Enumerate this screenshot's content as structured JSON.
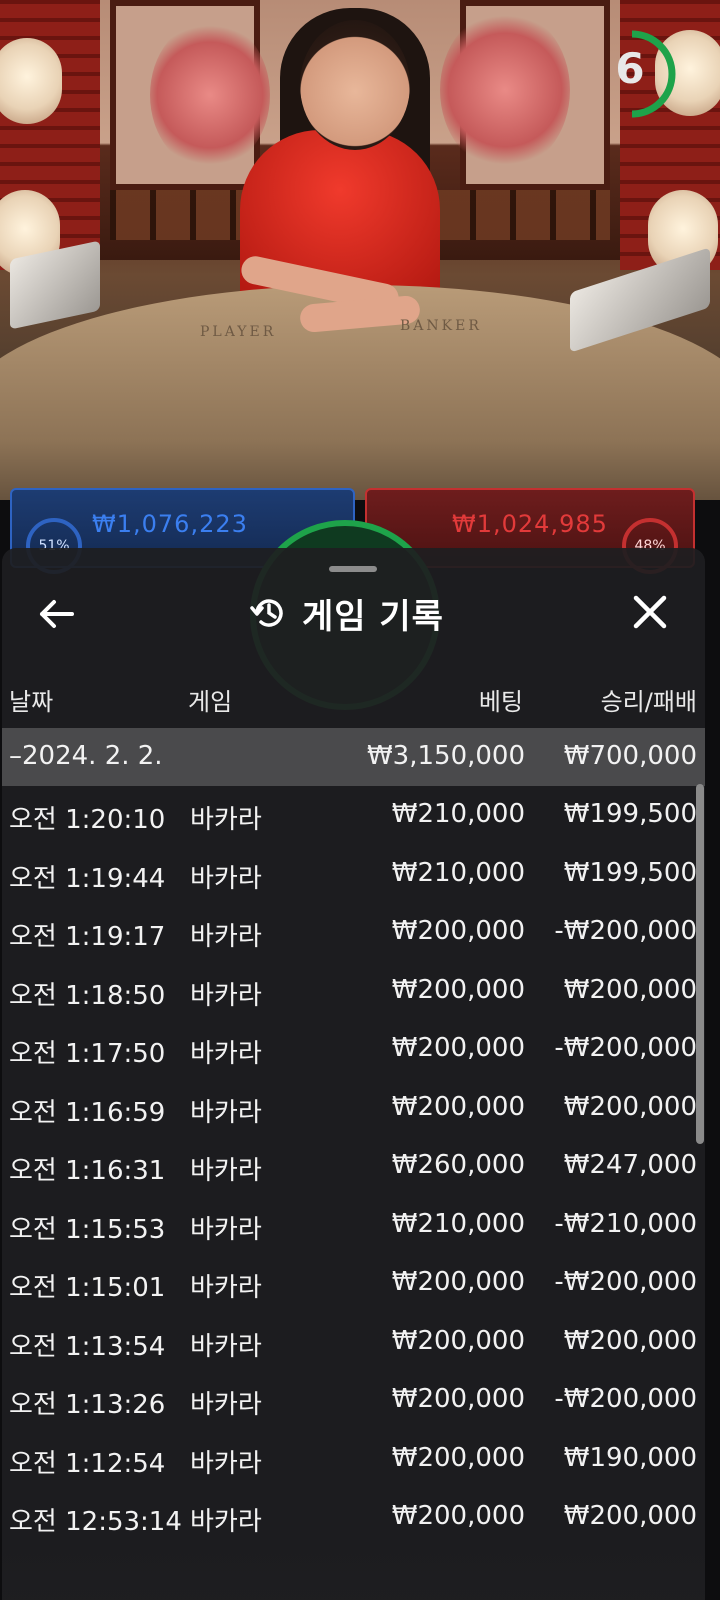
{
  "video": {
    "timer_value": "6",
    "table_label_player": "PLAYER",
    "table_label_banker": "BANKER"
  },
  "bet_panels": {
    "player_amount": "₩1,076,223",
    "player_percent": "51%",
    "banker_amount": "₩1,024,985",
    "banker_percent": "48%"
  },
  "sheet": {
    "title": "게임 기록",
    "back_icon": "arrow-left-icon",
    "history_icon": "history-icon",
    "close_icon": "close-icon",
    "columns": {
      "date": "날짜",
      "game": "게임",
      "bet": "베팅",
      "win_loss": "승리/패배"
    },
    "date_group": {
      "label": "–2024. 2. 2.",
      "bet_total": "₩3,150,000",
      "win_total": "₩700,000"
    },
    "rows": [
      {
        "time": "오전 1:20:10",
        "game": "바카라",
        "bet": "₩210,000",
        "result": "₩199,500"
      },
      {
        "time": "오전 1:19:44",
        "game": "바카라",
        "bet": "₩210,000",
        "result": "₩199,500"
      },
      {
        "time": "오전 1:19:17",
        "game": "바카라",
        "bet": "₩200,000",
        "result": "-₩200,000"
      },
      {
        "time": "오전 1:18:50",
        "game": "바카라",
        "bet": "₩200,000",
        "result": "₩200,000"
      },
      {
        "time": "오전 1:17:50",
        "game": "바카라",
        "bet": "₩200,000",
        "result": "-₩200,000"
      },
      {
        "time": "오전 1:16:59",
        "game": "바카라",
        "bet": "₩200,000",
        "result": "₩200,000"
      },
      {
        "time": "오전 1:16:31",
        "game": "바카라",
        "bet": "₩260,000",
        "result": "₩247,000"
      },
      {
        "time": "오전 1:15:53",
        "game": "바카라",
        "bet": "₩210,000",
        "result": "-₩210,000"
      },
      {
        "time": "오전 1:15:01",
        "game": "바카라",
        "bet": "₩200,000",
        "result": "-₩200,000"
      },
      {
        "time": "오전 1:13:54",
        "game": "바카라",
        "bet": "₩200,000",
        "result": "₩200,000"
      },
      {
        "time": "오전 1:13:26",
        "game": "바카라",
        "bet": "₩200,000",
        "result": "-₩200,000"
      },
      {
        "time": "오전 1:12:54",
        "game": "바카라",
        "bet": "₩200,000",
        "result": "₩190,000"
      },
      {
        "time": "오전 12:53:14",
        "game": "바카라",
        "bet": "₩200,000",
        "result": "₩200,000"
      }
    ]
  },
  "colors": {
    "sheet_bg": "#1e1e20",
    "date_row_bg": "#4a4a4c",
    "timer_green": "#1ea34a",
    "player_blue": "#2e63c2",
    "banker_red": "#c43030"
  }
}
